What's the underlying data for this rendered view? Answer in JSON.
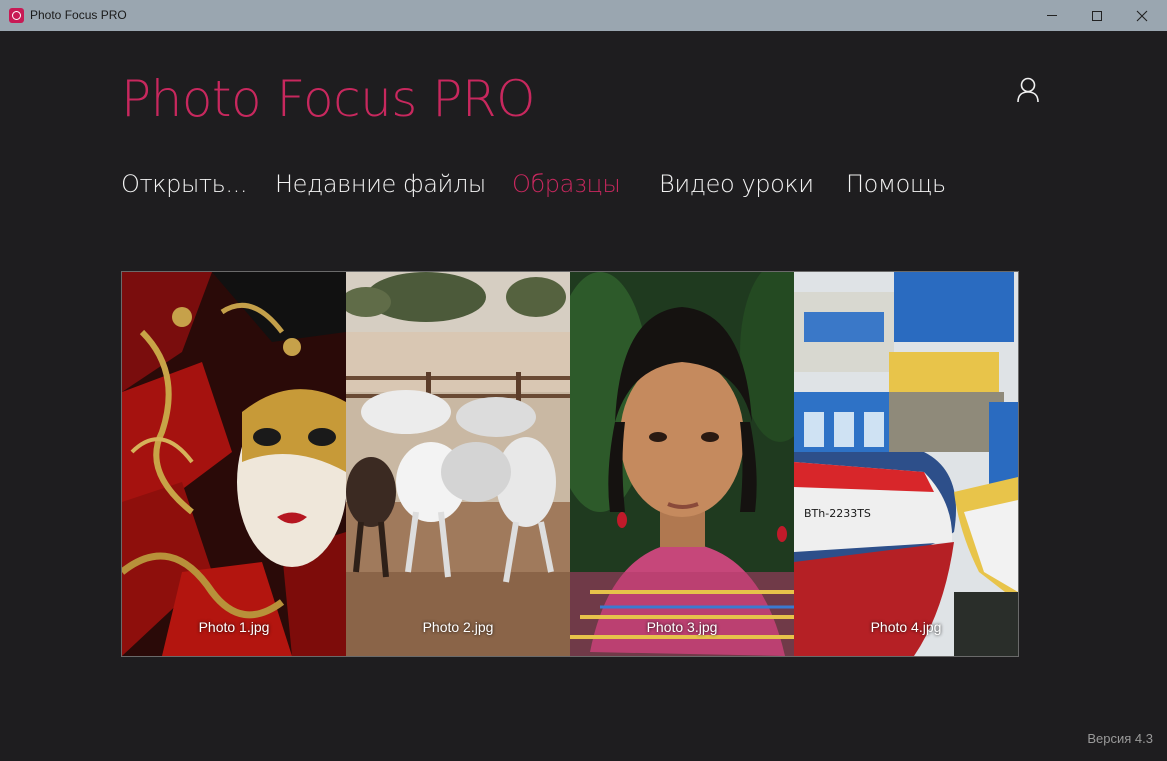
{
  "window": {
    "title": "Photo Focus PRO",
    "controls": [
      "minimize-icon",
      "maximize-icon",
      "close-icon"
    ]
  },
  "header": {
    "app_title": "Photo Focus PRO",
    "user_icon": "user-icon",
    "accent_color": "#c8285e"
  },
  "nav": {
    "items": [
      {
        "label": "Открыть..."
      },
      {
        "label": "Недавние файлы"
      },
      {
        "label": "Образцы",
        "active": true
      },
      {
        "label": "Видео уроки"
      },
      {
        "label": "Помощь"
      }
    ]
  },
  "samples": [
    {
      "label": "Photo 1.jpg"
    },
    {
      "label": "Photo 2.jpg"
    },
    {
      "label": "Photo 3.jpg"
    },
    {
      "label": "Photo 4.jpg"
    }
  ],
  "footer": {
    "version": "Версия 4.3"
  }
}
